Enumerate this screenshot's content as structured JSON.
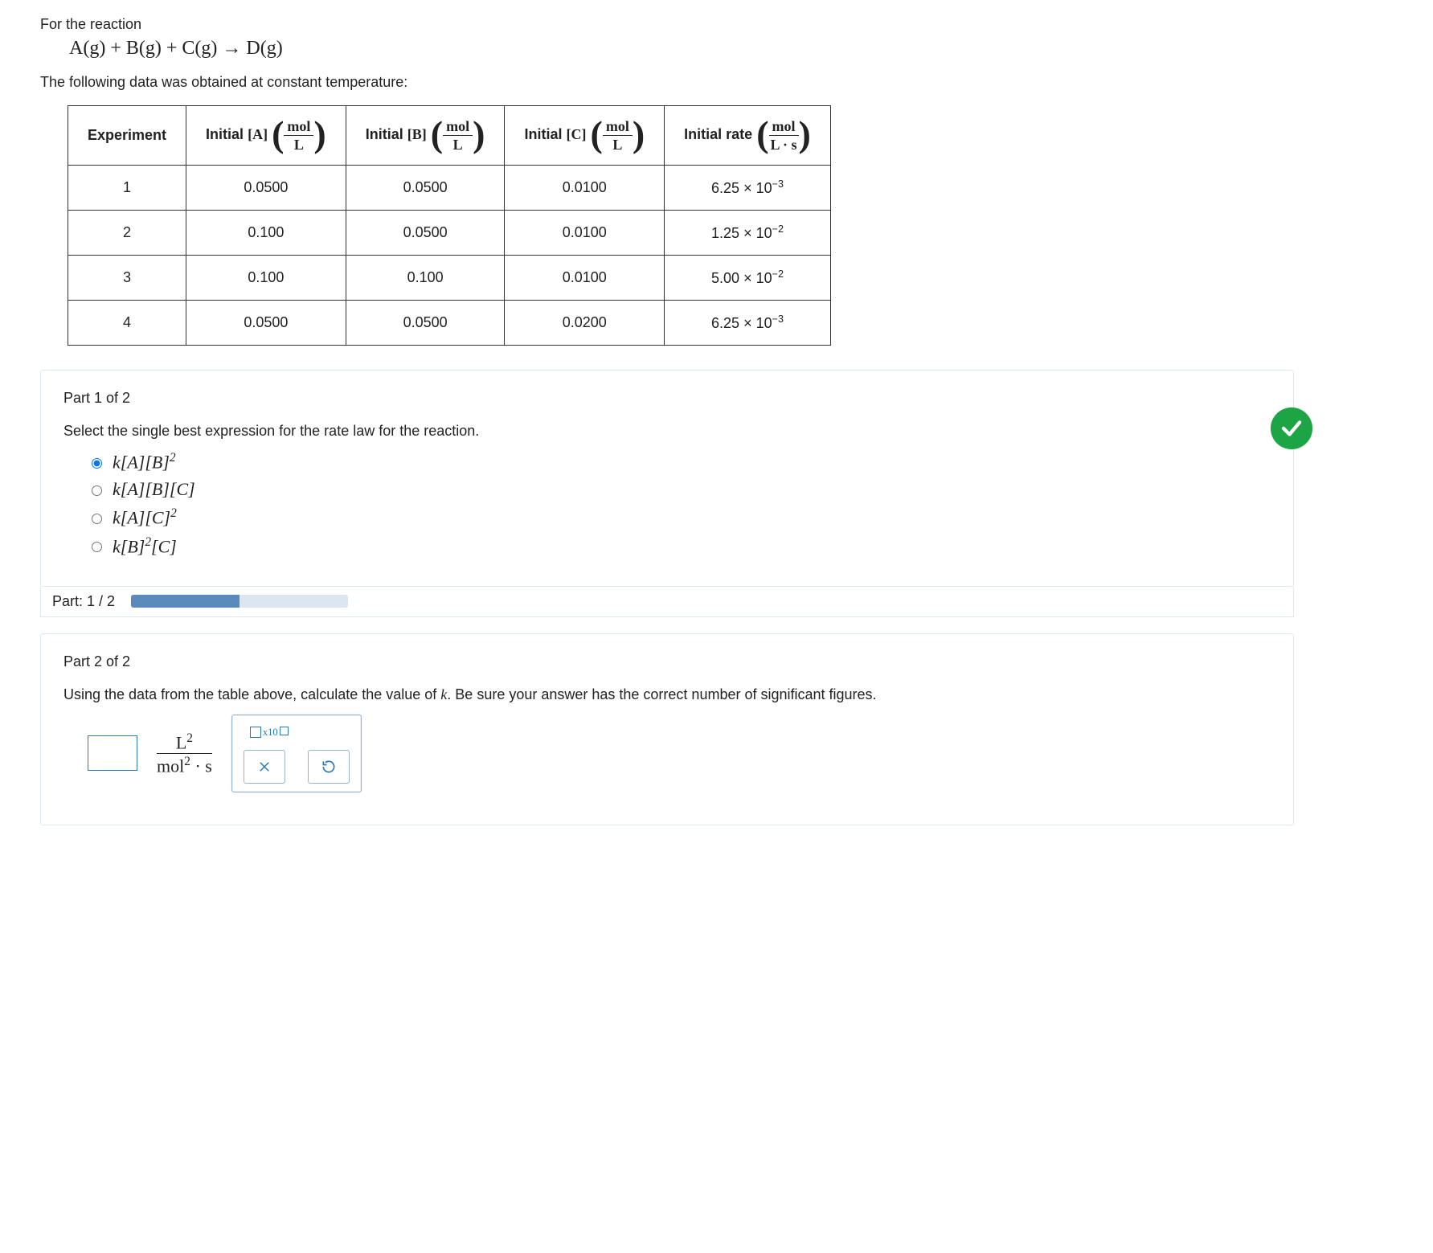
{
  "intro": "For the reaction",
  "reaction_html": "A(g) + B(g) + C(g) → D(g)",
  "after_data": "The following data was obtained at constant temperature:",
  "table": {
    "headers": {
      "c0": "Experiment",
      "c1_label": "Initial",
      "c1_sym": "[A]",
      "c2_label": "Initial",
      "c2_sym": "[B]",
      "c3_label": "Initial",
      "c3_sym": "[C]",
      "c4_label": "Initial rate",
      "unit_num": "mol",
      "unit_den": "L",
      "rate_unit_den": "L · s"
    },
    "rows": [
      {
        "exp": "1",
        "a": "0.0500",
        "b": "0.0500",
        "c": "0.0100",
        "rate_mant": "6.25",
        "rate_exp": "−3"
      },
      {
        "exp": "2",
        "a": "0.100",
        "b": "0.0500",
        "c": "0.0100",
        "rate_mant": "1.25",
        "rate_exp": "−2"
      },
      {
        "exp": "3",
        "a": "0.100",
        "b": "0.100",
        "c": "0.0100",
        "rate_mant": "5.00",
        "rate_exp": "−2"
      },
      {
        "exp": "4",
        "a": "0.0500",
        "b": "0.0500",
        "c": "0.0200",
        "rate_mant": "6.25",
        "rate_exp": "−3"
      }
    ]
  },
  "part1": {
    "label": "Part 1 of 2",
    "prompt": "Select the single best expression for the rate law for the reaction.",
    "options": [
      {
        "html": "k[A][B]<sup>2</sup>",
        "selected": true
      },
      {
        "html": "k[A][B][C]",
        "selected": false
      },
      {
        "html": "k[A][C]<sup>2</sup>",
        "selected": false
      },
      {
        "html": "k[B]<sup>2</sup>[C]",
        "selected": false
      }
    ],
    "correct": true
  },
  "progress": {
    "label": "Part: 1 / 2",
    "pct": 50
  },
  "part2": {
    "label": "Part 2 of 2",
    "prompt_html": "Using the data from the table above, calculate the value of <span class='mathser' style='font-style:italic'>k</span>. Be sure your answer has the correct number of significant figures.",
    "units_num": "L",
    "units_num_exp": "2",
    "units_den": "mol",
    "units_den_exp": "2",
    "units_den_tail": " · s",
    "tool_sci_sub": "x10"
  }
}
